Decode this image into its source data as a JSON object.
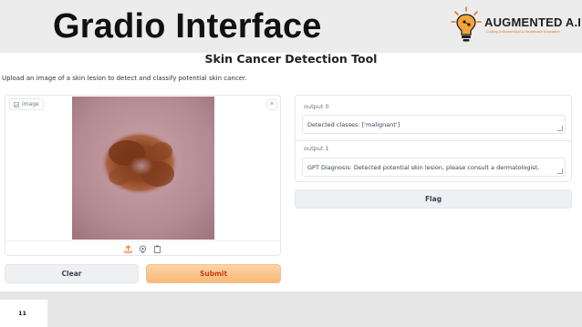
{
  "banner": {
    "title": "Gradio Interface",
    "logo_text": "AUGMENTED A.I.",
    "logo_tagline": "Coding in Biomedical & Healthcare Education"
  },
  "app": {
    "title": "Skin Cancer Detection Tool",
    "description": "Upload an image of a skin lesion to detect and classify potential skin cancer."
  },
  "image_input": {
    "label": "image",
    "close_icon": "×",
    "toolbar_icons": [
      "upload-icon",
      "webcam-icon",
      "clipboard-icon"
    ]
  },
  "outputs": [
    {
      "label": "output 0",
      "value": "Detected classes: ['malignant']"
    },
    {
      "label": "output 1",
      "value": "GPT Diagnosis: Detected potential skin lesion, please consult a dermatologist."
    }
  ],
  "buttons": {
    "clear": "Clear",
    "submit": "Submit",
    "flag": "Flag"
  },
  "slide_number": "11",
  "colors": {
    "accent": "#f97316",
    "submit_bg": "#fbc48f",
    "neutral_button": "#eef0f3",
    "banner_bg": "#ececec"
  }
}
